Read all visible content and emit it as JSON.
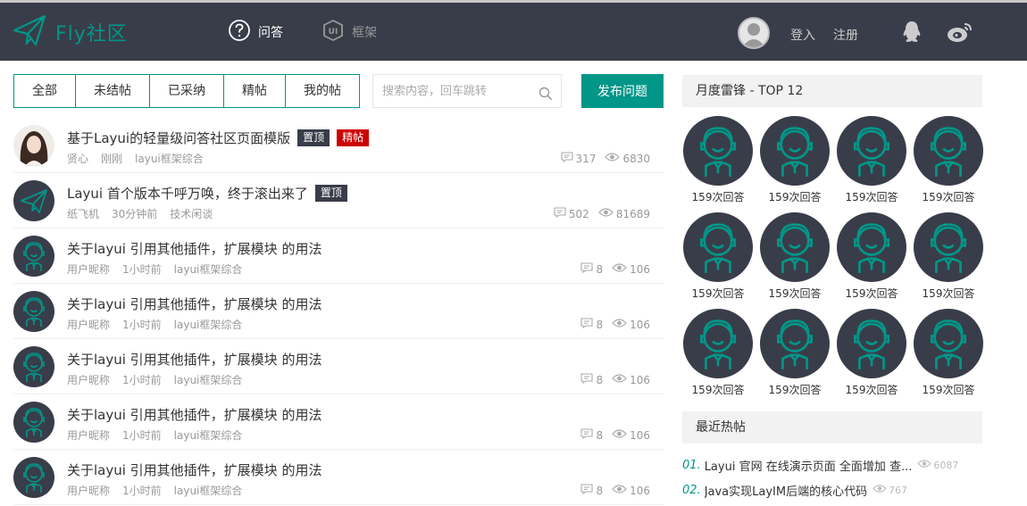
{
  "header": {
    "logo_text": "Fly社区",
    "nav": [
      {
        "label": "问答",
        "icon": "question-circle-icon"
      },
      {
        "label": "框架",
        "icon": "ui-shield-icon"
      }
    ],
    "login": "登入",
    "register": "注册"
  },
  "toolbar": {
    "tabs": [
      "全部",
      "未结帖",
      "已采纳",
      "精帖",
      "我的帖"
    ],
    "search_placeholder": "搜索内容，回车跳转",
    "publish_label": "发布问题"
  },
  "posts": [
    {
      "title": "基于Layui的轻量级问答社区页面模版",
      "badges": [
        "置顶",
        "精帖"
      ],
      "author": "贤心",
      "time": "刚刚",
      "category": "layui框架综合",
      "replies": "317",
      "views": "6830",
      "avatar": "photo"
    },
    {
      "title": "Layui 首个版本千呼万唤，终于滚出来了",
      "badges": [
        "置顶"
      ],
      "author": "纸飞机",
      "time": "30分钟前",
      "category": "技术闲谈",
      "replies": "502",
      "views": "81689",
      "avatar": "plane"
    },
    {
      "title": "关于layui 引用其他插件，扩展模块 的用法",
      "badges": [],
      "author": "用户昵称",
      "time": "1小时前",
      "category": "layui框架综合",
      "replies": "8",
      "views": "106",
      "avatar": "default"
    },
    {
      "title": "关于layui 引用其他插件，扩展模块 的用法",
      "badges": [],
      "author": "用户昵称",
      "time": "1小时前",
      "category": "layui框架综合",
      "replies": "8",
      "views": "106",
      "avatar": "default"
    },
    {
      "title": "关于layui 引用其他插件，扩展模块 的用法",
      "badges": [],
      "author": "用户昵称",
      "time": "1小时前",
      "category": "layui框架综合",
      "replies": "8",
      "views": "106",
      "avatar": "default"
    },
    {
      "title": "关于layui 引用其他插件，扩展模块 的用法",
      "badges": [],
      "author": "用户昵称",
      "time": "1小时前",
      "category": "layui框架综合",
      "replies": "8",
      "views": "106",
      "avatar": "default"
    },
    {
      "title": "关于layui 引用其他插件，扩展模块 的用法",
      "badges": [],
      "author": "用户昵称",
      "time": "1小时前",
      "category": "layui框架综合",
      "replies": "8",
      "views": "106",
      "avatar": "default"
    }
  ],
  "sidebar": {
    "top_title": "月度雷锋 - TOP 12",
    "top_users": [
      "159次回答",
      "159次回答",
      "159次回答",
      "159次回答",
      "159次回答",
      "159次回答",
      "159次回答",
      "159次回答",
      "159次回答",
      "159次回答",
      "159次回答",
      "159次回答"
    ],
    "hot_title": "最近热帖",
    "hot_posts": [
      {
        "num": "01.",
        "title": "Layui 官网 在线演示页面 全面增加 查...",
        "views": "6087"
      },
      {
        "num": "02.",
        "title": "Java实现LayIM后端的核心代码",
        "views": "767"
      }
    ]
  },
  "colors": {
    "accent": "#009688",
    "header_bg": "#393D49",
    "badge_good": "#cc0000"
  }
}
